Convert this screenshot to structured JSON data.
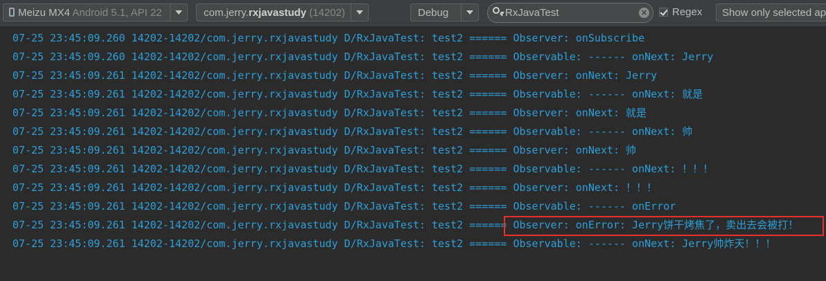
{
  "toolbar": {
    "device": {
      "name": "Meizu MX4",
      "details": "Android 5.1, API 22"
    },
    "process": {
      "prefix": "com.jerry.",
      "name_bold": "rxjavastudy",
      "pid": "(14202)"
    },
    "log_level": "Debug",
    "search": {
      "value": "RxJavaTest"
    },
    "regex_label": "Regex",
    "filter_label": "Show only selected ap"
  },
  "log": {
    "lines": [
      "07-25 23:45:09.260 14202-14202/com.jerry.rxjavastudy D/RxJavaTest: test2 ====== Observer: onSubscribe",
      "07-25 23:45:09.260 14202-14202/com.jerry.rxjavastudy D/RxJavaTest: test2 ====== Observable: ------ onNext: Jerry",
      "07-25 23:45:09.261 14202-14202/com.jerry.rxjavastudy D/RxJavaTest: test2 ====== Observer: onNext: Jerry",
      "07-25 23:45:09.261 14202-14202/com.jerry.rxjavastudy D/RxJavaTest: test2 ====== Observable: ------ onNext: 就是",
      "07-25 23:45:09.261 14202-14202/com.jerry.rxjavastudy D/RxJavaTest: test2 ====== Observer: onNext: 就是",
      "07-25 23:45:09.261 14202-14202/com.jerry.rxjavastudy D/RxJavaTest: test2 ====== Observable: ------ onNext: 帅",
      "07-25 23:45:09.261 14202-14202/com.jerry.rxjavastudy D/RxJavaTest: test2 ====== Observer: onNext: 帅",
      "07-25 23:45:09.261 14202-14202/com.jerry.rxjavastudy D/RxJavaTest: test2 ====== Observable: ------ onNext: ！！！",
      "07-25 23:45:09.261 14202-14202/com.jerry.rxjavastudy D/RxJavaTest: test2 ====== Observer: onNext: ！！！",
      "07-25 23:45:09.261 14202-14202/com.jerry.rxjavastudy D/RxJavaTest: test2 ====== Observable: ------ onError",
      "07-25 23:45:09.261 14202-14202/com.jerry.rxjavastudy D/RxJavaTest: test2 ====== Observer: onError: Jerry饼干烤焦了，卖出去会被打！",
      "07-25 23:45:09.261 14202-14202/com.jerry.rxjavastudy D/RxJavaTest: test2 ====== Observable: ------ onNext: Jerry帅炸天！！！"
    ]
  },
  "colors": {
    "log_text": "#2d9fd9",
    "background": "#2b2b2b",
    "toolbar": "#3c3f41",
    "highlight": "#e8302b"
  }
}
